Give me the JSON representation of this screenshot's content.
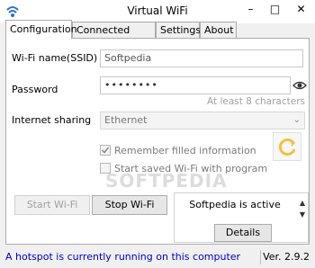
{
  "window": {
    "title": "Virtual WiFi",
    "min_glyph": "–",
    "max_glyph": "□",
    "close_glyph": "✕"
  },
  "tabs": [
    {
      "label": "Configuration",
      "active": true
    },
    {
      "label": "Connected clients",
      "active": false
    },
    {
      "label": "Settings",
      "active": false
    },
    {
      "label": "About",
      "active": false
    }
  ],
  "config": {
    "ssid_label": "Wi-Fi name(SSID)",
    "ssid_value": "Softpedia",
    "password_label": "Password",
    "password_value": "••••••••",
    "password_hint": "At least 8 characters",
    "sharing_label": "Internet sharing",
    "sharing_selected": "Ethernet",
    "remember_label": "Remember filled information",
    "remember_checked": true,
    "start_saved_label": "Start saved Wi-Fi with program",
    "start_saved_checked": false
  },
  "buttons": {
    "start_label": "Start Wi-Fi",
    "stop_label": "Stop Wi-Fi",
    "details_label": "Details"
  },
  "status_box": {
    "text": "Softpedia is active"
  },
  "statusbar": {
    "message": "A hotspot is currently running on this computer",
    "version": "Ver. 2.9.2"
  },
  "watermark": "SOFTPEDIA",
  "colors": {
    "status_text": "#0000cc",
    "refresh_icon": "#f4c040"
  }
}
